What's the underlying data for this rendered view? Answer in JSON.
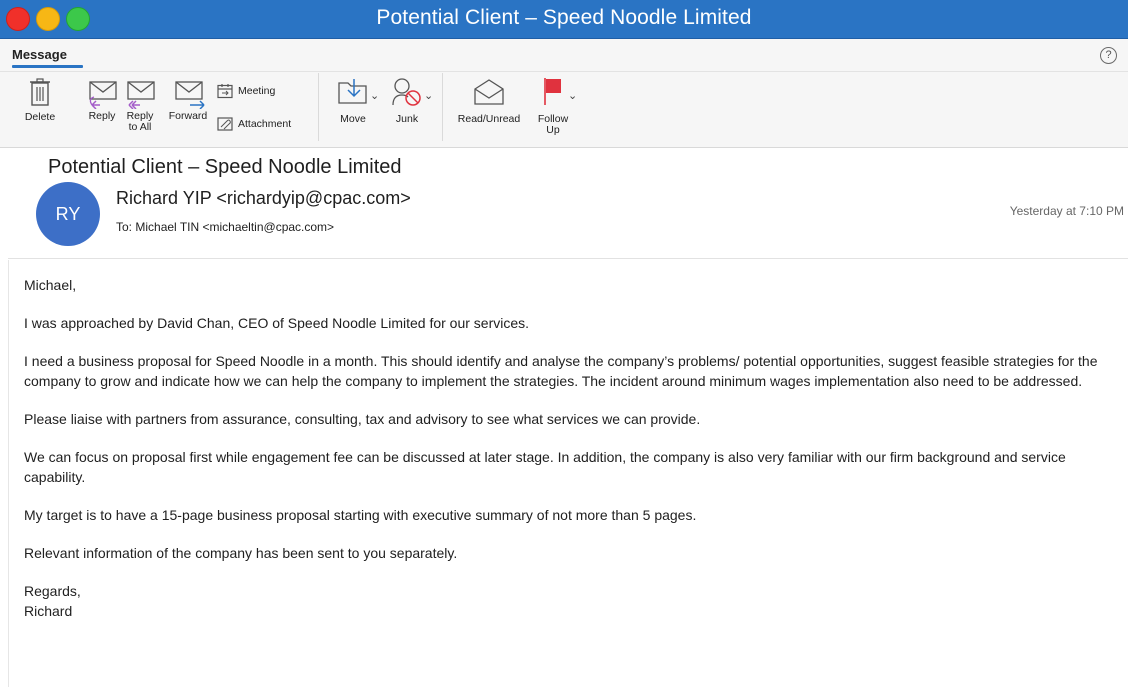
{
  "window": {
    "title": "Potential Client – Speed Noodle Limited"
  },
  "ribbon": {
    "tab": "Message",
    "help": "?",
    "buttons": {
      "delete": "Delete",
      "reply": "Reply",
      "reply_all_1": "Reply",
      "reply_all_2": "to All",
      "forward": "Forward",
      "meeting": "Meeting",
      "attachment": "Attachment",
      "move": "Move",
      "junk": "Junk",
      "read_unread": "Read/Unread",
      "follow_up_1": "Follow",
      "follow_up_2": "Up"
    }
  },
  "message": {
    "subject": "Potential Client – Speed Noodle Limited",
    "avatar_initials": "RY",
    "sender": "Richard YIP <richardyip@cpac.com>",
    "to_label": "To:",
    "to": "Michael TIN <michaeltin@cpac.com>",
    "timestamp": "Yesterday at 7:10 PM",
    "body": {
      "greeting": "Michael,",
      "p1": "I was approached by David Chan, CEO of Speed Noodle Limited for our services.",
      "p2": "I need a business proposal for Speed Noodle in a month. This should identify and analyse the company’s problems/ potential opportunities, suggest feasible strategies for the company to grow and indicate how we can help the company to implement the strategies. The incident around minimum wages implementation also need to be addressed.",
      "p3": "Please liaise with partners from assurance, consulting, tax and advisory to see what services we can provide.",
      "p4": "We can focus on proposal first while engagement fee can be discussed at later stage. In addition, the company is also very familiar with our firm background and service capability.",
      "p5": "My target is to have a 15-page business proposal starting with executive summary of not more than 5 pages.",
      "p6": "Relevant information of the company has been sent to you separately.",
      "closing": "Regards,",
      "signature": "Richard"
    }
  },
  "colors": {
    "titlebar": "#2a74c4",
    "avatar": "#3d6fc7",
    "accent": "#2a74c4",
    "flag": "#e0323e"
  },
  "icons": [
    "trash-icon",
    "reply-icon",
    "reply-all-icon",
    "forward-icon",
    "calendar-icon",
    "paperclip-icon",
    "move-icon",
    "junk-icon",
    "envelope-open-icon",
    "flag-icon",
    "help-icon"
  ]
}
